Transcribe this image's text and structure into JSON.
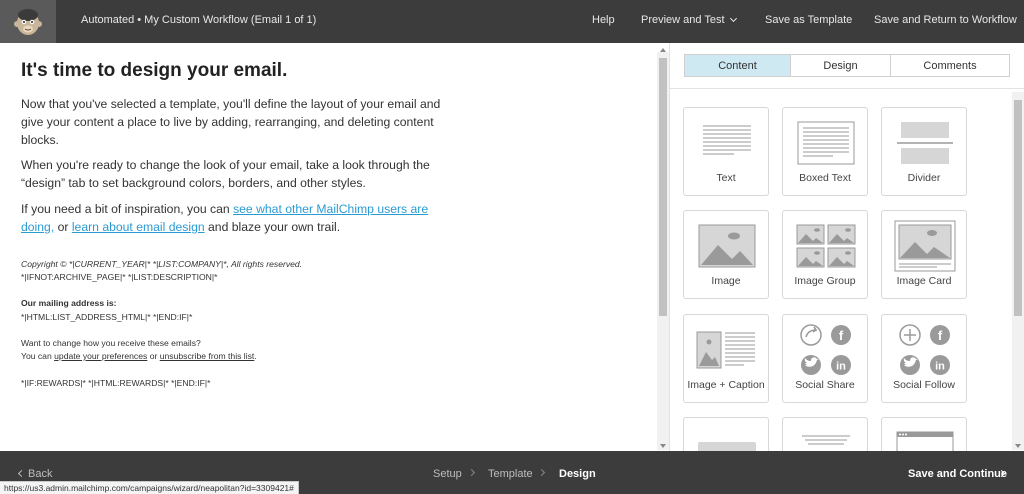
{
  "topbar": {
    "title": "Automated • My Custom Workflow (Email 1 of 1)",
    "help": "Help",
    "preview": "Preview and Test",
    "save_template": "Save as Template",
    "save_return": "Save and Return to Workflow"
  },
  "main": {
    "heading": "It's time to design your email.",
    "p1": "Now that you've selected a template, you'll define the layout of your email and give your content a place to live by adding, rearranging, and deleting content blocks.",
    "p2": "When you're ready to change the look of your email, take a look through the “design” tab to set background colors, borders, and other styles.",
    "p3_start": "If you need a bit of inspiration, you can ",
    "p3_link1": "see what other MailChimp users are doing,",
    "p3_mid": " or ",
    "p3_link2": "learn about email design",
    "p3_end": " and blaze your own trail."
  },
  "footer": {
    "copyright": "Copyright © *|CURRENT_YEAR|* *|LIST:COMPANY|*, All rights reserved.",
    "archive": "*|IFNOT:ARCHIVE_PAGE|* *|LIST:DESCRIPTION|*",
    "mailing_heading": "Our mailing address is:",
    "address": "*|HTML:LIST_ADDRESS_HTML|* *|END:IF|*",
    "change_q": "Want to change how you receive these emails?",
    "can_text": "You can ",
    "update_link": "update your preferences",
    "or_text": " or ",
    "unsub_link": "unsubscribe from this list",
    "period": ".",
    "rewards": "*|IF:REWARDS|* *|HTML:REWARDS|* *|END:IF|*"
  },
  "panel": {
    "tabs": [
      "Content",
      "Design",
      "Comments"
    ],
    "active_tab": "Content",
    "blocks": [
      {
        "label": "Text",
        "icon": "text-block-icon"
      },
      {
        "label": "Boxed Text",
        "icon": "boxed-text-icon"
      },
      {
        "label": "Divider",
        "icon": "divider-icon"
      },
      {
        "label": "Image",
        "icon": "image-icon"
      },
      {
        "label": "Image Group",
        "icon": "image-group-icon"
      },
      {
        "label": "Image Card",
        "icon": "image-card-icon"
      },
      {
        "label": "Image + Caption",
        "icon": "image-caption-icon"
      },
      {
        "label": "Social Share",
        "icon": "social-share-icon"
      },
      {
        "label": "Social Follow",
        "icon": "social-follow-icon"
      }
    ]
  },
  "bottombar": {
    "back": "Back",
    "steps": [
      "Setup",
      "Template",
      "Design"
    ],
    "current_step": "Design",
    "continue": "Save and Continue"
  },
  "status_url": "https://us3.admin.mailchimp.com/campaigns/wizard/neapolitan?id=3309421#",
  "colors": {
    "topbar_bg": "#3c3c3c",
    "link": "#2a9bd2",
    "active_tab": "#cfe9f3"
  }
}
